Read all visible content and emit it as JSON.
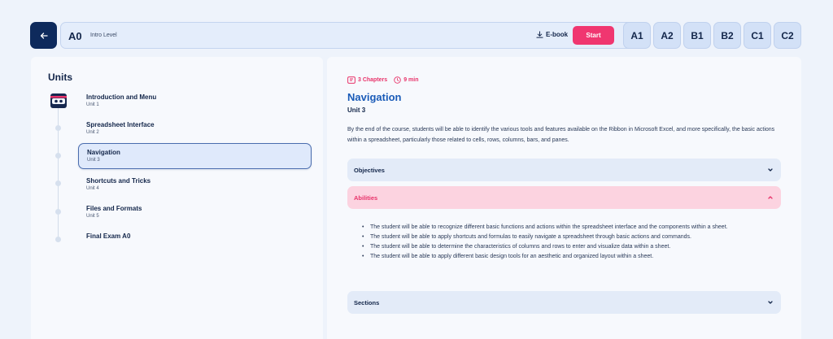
{
  "header": {
    "level_code": "A0",
    "level_name": "Intro Level",
    "ebook_label": "E-book",
    "start_label": "Start",
    "levels": [
      "A1",
      "A2",
      "B1",
      "B2",
      "C1",
      "C2"
    ]
  },
  "sidebar": {
    "title": "Units",
    "units": [
      {
        "name": "Introduction and Menu",
        "sub": "Unit 1"
      },
      {
        "name": "Spreadsheet Interface",
        "sub": "Unit 2"
      },
      {
        "name": "Navigation",
        "sub": "Unit 3"
      },
      {
        "name": "Shortcuts and Tricks",
        "sub": "Unit 4"
      },
      {
        "name": "Files and Formats",
        "sub": "Unit 5"
      },
      {
        "name": "Final Exam A0",
        "sub": ""
      }
    ],
    "active_index": 2
  },
  "detail": {
    "chapters": "3 Chapters",
    "duration": "9 min",
    "title": "Navigation",
    "unit": "Unit 3",
    "description": "By the end of the course, students will be able to identify the various tools and features available on the Ribbon in Microsoft Excel, and more specifically, the basic actions within a spreadsheet, particularly those related to cells, rows, columns, bars, and panes.",
    "objectives_label": "Objectives",
    "abilities_label": "Abilities",
    "sections_label": "Sections",
    "abilities": [
      "The student will be able to recognize different basic functions and actions within the spreadsheet interface and the components within a sheet.",
      "The student will be able to apply shortcuts and formulas to easily navigate a spreadsheet through basic actions and commands.",
      "The student will be able to determine the characteristics of columns and rows to enter and visualize data within a sheet.",
      "The student will be able to apply different basic design tools for an aesthetic and organized layout within a sheet."
    ]
  },
  "colors": {
    "accent_pink": "#f03670",
    "navy": "#0e2a5c",
    "title_blue": "#1a5bb8"
  },
  "icons": [
    "arrow-left-icon",
    "download-icon",
    "book-icon",
    "clock-icon",
    "chevron-down-icon",
    "chevron-up-icon",
    "ninja-avatar-icon"
  ]
}
